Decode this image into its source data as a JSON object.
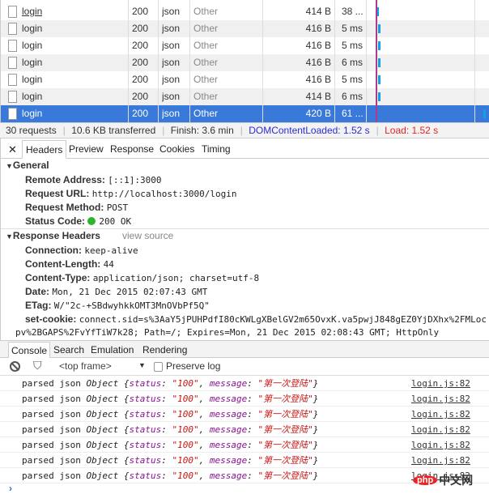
{
  "network": {
    "rows": [
      {
        "name": "login",
        "status": "200",
        "type": "json",
        "initiator": "Other",
        "size": "414 B",
        "time": "38 ..."
      },
      {
        "name": "login",
        "status": "200",
        "type": "json",
        "initiator": "Other",
        "size": "416 B",
        "time": "5 ms"
      },
      {
        "name": "login",
        "status": "200",
        "type": "json",
        "initiator": "Other",
        "size": "416 B",
        "time": "5 ms"
      },
      {
        "name": "login",
        "status": "200",
        "type": "json",
        "initiator": "Other",
        "size": "416 B",
        "time": "6 ms"
      },
      {
        "name": "login",
        "status": "200",
        "type": "json",
        "initiator": "Other",
        "size": "416 B",
        "time": "5 ms"
      },
      {
        "name": "login",
        "status": "200",
        "type": "json",
        "initiator": "Other",
        "size": "414 B",
        "time": "6 ms"
      },
      {
        "name": "login",
        "status": "200",
        "type": "json",
        "initiator": "Other",
        "size": "420 B",
        "time": "61 ...",
        "selected": true
      }
    ],
    "summary": {
      "requests": "30 requests",
      "transferred": "10.6 KB transferred",
      "finish": "Finish: 3.6 min",
      "dcl": "DOMContentLoaded: 1.52 s",
      "load": "Load: 1.52 s"
    },
    "colors": {
      "selected": "#3879d9",
      "dcl": "#2b2bd8",
      "load": "#e52222",
      "bar": "#0fa0e8",
      "marker": "#b03a8a"
    }
  },
  "detail_tabs": [
    "Headers",
    "Preview",
    "Response",
    "Cookies",
    "Timing"
  ],
  "general": {
    "title": "General",
    "items": [
      {
        "k": "Remote Address:",
        "v": "[::1]:3000"
      },
      {
        "k": "Request URL:",
        "v": "http://localhost:3000/login"
      },
      {
        "k": "Request Method:",
        "v": "POST"
      },
      {
        "k": "Status Code:",
        "v": "200 OK"
      }
    ]
  },
  "response_headers": {
    "title": "Response Headers",
    "view_source": "view source",
    "items": [
      {
        "k": "Connection:",
        "v": "keep-alive"
      },
      {
        "k": "Content-Length:",
        "v": "44"
      },
      {
        "k": "Content-Type:",
        "v": "application/json; charset=utf-8"
      },
      {
        "k": "Date:",
        "v": "Mon, 21 Dec 2015 02:07:43 GMT"
      },
      {
        "k": "ETag:",
        "v": "W/\"2c-+SBdwyhkkOMT3MnOVbPf5Q\""
      },
      {
        "k": "set-cookie:",
        "v": "connect.sid=s%3AaY5jPUHPdfI80cKWLgXBelGV2m65OvxK.va5pwjJ848gEZ0YjDXhx%2FMLoc"
      }
    ],
    "cookie_wrap": "pv%2BGAPS%2FvYfTiW7k28; Path=/; Expires=Mon, 21 Dec 2015 02:08:43 GMT; HttpOnly"
  },
  "drawer_tabs": [
    "Console",
    "Search",
    "Emulation",
    "Rendering"
  ],
  "console": {
    "frame": "<top frame>",
    "preserve_log": "Preserve log",
    "logs": [
      {
        "prefix": "parsed json ",
        "obj": "Object ",
        "k1": "status",
        "v1": "\"100\"",
        "k2": "message",
        "v2": "\"第一次登陆\"",
        "src": "login.js:82"
      },
      {
        "prefix": "parsed json ",
        "obj": "Object ",
        "k1": "status",
        "v1": "\"100\"",
        "k2": "message",
        "v2": "\"第一次登陆\"",
        "src": "login.js:82"
      },
      {
        "prefix": "parsed json ",
        "obj": "Object ",
        "k1": "status",
        "v1": "\"100\"",
        "k2": "message",
        "v2": "\"第一次登陆\"",
        "src": "login.js:82"
      },
      {
        "prefix": "parsed json ",
        "obj": "Object ",
        "k1": "status",
        "v1": "\"100\"",
        "k2": "message",
        "v2": "\"第一次登陆\"",
        "src": "login.js:82"
      },
      {
        "prefix": "parsed json ",
        "obj": "Object ",
        "k1": "status",
        "v1": "\"100\"",
        "k2": "message",
        "v2": "\"第一次登陆\"",
        "src": "login.js:82"
      },
      {
        "prefix": "parsed json ",
        "obj": "Object ",
        "k1": "status",
        "v1": "\"100\"",
        "k2": "message",
        "v2": "\"第一次登陆\"",
        "src": "login.js:82"
      },
      {
        "prefix": "parsed json ",
        "obj": "Object ",
        "k1": "status",
        "v1": "\"100\"",
        "k2": "message",
        "v2": "\"第一次登陆\"",
        "src": "login.js:82"
      }
    ],
    "prompt": "›"
  },
  "watermark": "php中文网"
}
